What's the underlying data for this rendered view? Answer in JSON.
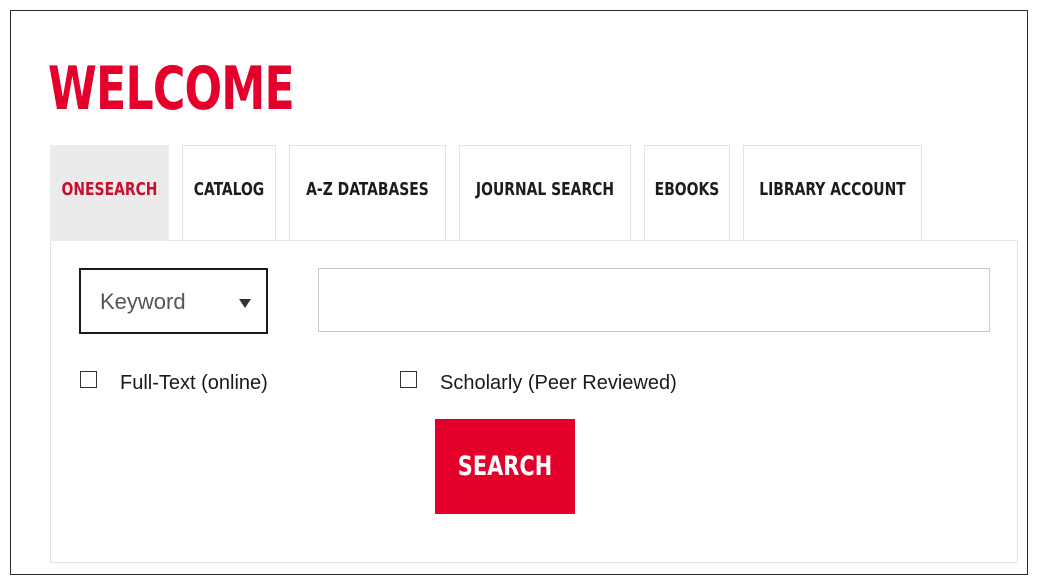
{
  "header": {
    "title": "WELCOME"
  },
  "tabs": [
    {
      "label": "ONESEARCH",
      "active": true
    },
    {
      "label": "CATALOG",
      "active": false
    },
    {
      "label": "A-Z DATABASES",
      "active": false
    },
    {
      "label": "JOURNAL SEARCH",
      "active": false
    },
    {
      "label": "EBOOKS",
      "active": false
    },
    {
      "label": "LIBRARY ACCOUNT",
      "active": false
    }
  ],
  "search": {
    "field_type": {
      "selected": "Keyword",
      "icon": "caret-down-icon"
    },
    "query_value": "",
    "placeholder": ""
  },
  "filters": [
    {
      "label": "Full-Text (online)",
      "checked": false
    },
    {
      "label": "Scholarly (Peer Reviewed)",
      "checked": false
    }
  ],
  "search_button": {
    "label": "SEARCH"
  },
  "colors": {
    "accent": "#e4002b",
    "active_tab_text": "#c8102e",
    "active_tab_bg": "#ebebeb"
  }
}
